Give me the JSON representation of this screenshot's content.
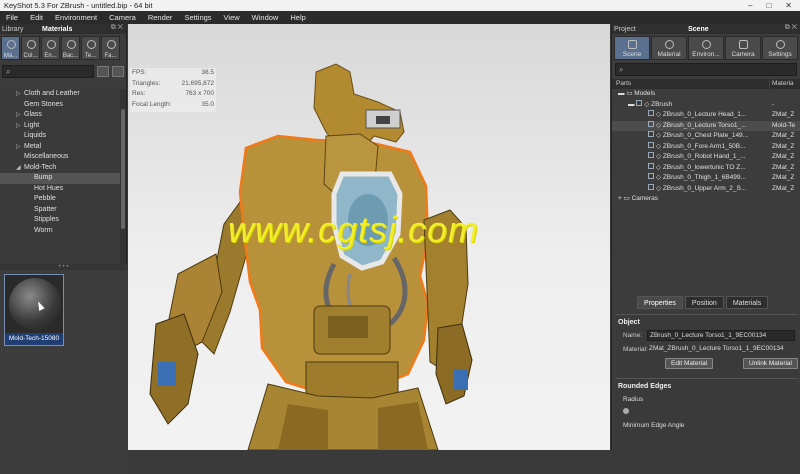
{
  "window": {
    "title": "KeyShot 5.3 For ZBrush - untitled.bip - 64 bit"
  },
  "menu": [
    "File",
    "Edit",
    "Environment",
    "Camera",
    "Render",
    "Settings",
    "View",
    "Window",
    "Help"
  ],
  "library": {
    "header_label": "Library",
    "header_title": "Materials",
    "tabs": [
      {
        "label": "Ma...",
        "icon": "materials-icon",
        "selected": true
      },
      {
        "label": "Col...",
        "icon": "colors-icon"
      },
      {
        "label": "En...",
        "icon": "environments-icon"
      },
      {
        "label": "Bac...",
        "icon": "backplates-icon"
      },
      {
        "label": "Te...",
        "icon": "textures-icon"
      },
      {
        "label": "Fa...",
        "icon": "favorites-icon"
      }
    ],
    "tree": [
      {
        "label": "Cloth and Leather",
        "level": 1,
        "arrow": "▷"
      },
      {
        "label": "Gem Stones",
        "level": 1,
        "arrow": ""
      },
      {
        "label": "Glass",
        "level": 1,
        "arrow": "▷"
      },
      {
        "label": "Light",
        "level": 1,
        "arrow": "▷"
      },
      {
        "label": "Liquids",
        "level": 1,
        "arrow": ""
      },
      {
        "label": "Metal",
        "level": 1,
        "arrow": "▷"
      },
      {
        "label": "Miscellaneous",
        "level": 1,
        "arrow": ""
      },
      {
        "label": "Mold-Tech",
        "level": 1,
        "arrow": "◢"
      },
      {
        "label": "Bump",
        "level": 2,
        "arrow": "",
        "selected": true
      },
      {
        "label": "Hot Hues",
        "level": 2,
        "arrow": ""
      },
      {
        "label": "Pebble",
        "level": 2,
        "arrow": ""
      },
      {
        "label": "Spatter",
        "level": 2,
        "arrow": ""
      },
      {
        "label": "Stipples",
        "level": 2,
        "arrow": ""
      },
      {
        "label": "Worm",
        "level": 2,
        "arrow": ""
      }
    ],
    "thumbnail_caption": "Mold-Tech-15080"
  },
  "stats": {
    "fps_label": "FPS:",
    "fps": "38.5",
    "tri_label": "Triangles:",
    "triangles": "21,695,872",
    "res_label": "Res:",
    "res": "763 x 700",
    "focal_label": "Focal Length:",
    "focal": "35.0"
  },
  "watermark": "www.cgtsj.com",
  "project": {
    "header_label": "Project",
    "header_title": "Scene",
    "tabs": [
      {
        "label": "Scene",
        "icon": "scene-icon",
        "selected": true
      },
      {
        "label": "Material",
        "icon": "material-icon"
      },
      {
        "label": "Environ...",
        "icon": "environment-icon"
      },
      {
        "label": "Camera",
        "icon": "camera-icon"
      },
      {
        "label": "Settings",
        "icon": "settings-icon"
      }
    ],
    "columns": {
      "parts": "Parts",
      "material": "Materia"
    },
    "tree": [
      {
        "name": "Models",
        "level": 0,
        "arrow": "▬",
        "material": ""
      },
      {
        "name": "ZBrush",
        "level": 1,
        "arrow": "▬",
        "material": "-"
      },
      {
        "name": "ZBrush_0_Lecture Head_1...",
        "level": 2,
        "check": true,
        "material": "ZMat_Z"
      },
      {
        "name": "ZBrush_0_Lecture Torso1_...",
        "level": 2,
        "check": true,
        "material": "Mold-Te",
        "selected": true
      },
      {
        "name": "ZBrush_0_Chest Plate_149...",
        "level": 2,
        "check": true,
        "material": "ZMat_Z"
      },
      {
        "name": "ZBrush_0_Fore Arm1_50B...",
        "level": 2,
        "check": true,
        "material": "ZMat_Z"
      },
      {
        "name": "ZBrush_0_Robot Hand_1_...",
        "level": 2,
        "check": true,
        "material": "ZMat_Z"
      },
      {
        "name": "ZBrush_0_lowertunic TO Z...",
        "level": 2,
        "check": true,
        "material": "ZMat_Z"
      },
      {
        "name": "ZBrush_0_Thigh_1_6B499...",
        "level": 2,
        "check": true,
        "material": "ZMat_Z"
      },
      {
        "name": "ZBrush_0_Upper Arm_2_S...",
        "level": 2,
        "check": true,
        "material": "ZMat_Z"
      },
      {
        "name": "Cameras",
        "level": 0,
        "arrow": "+",
        "material": ""
      }
    ],
    "prop_tabs": [
      "Properties",
      "Position",
      "Materials"
    ],
    "object_group": "Object",
    "name_label": "Name:",
    "name_value": "ZBrush_0_Lecture Torso1_1_9EC00134",
    "material_label": "Material:",
    "material_value": "ZMat_ZBrush_0_Lecture Torso1_1_9EC00134",
    "edit_material": "Edit Material",
    "unlink_material": "Unlink Material",
    "rounded_group": "Rounded Edges",
    "radius_label": "Radius",
    "min_edge_label": "Minimum Edge Angle"
  }
}
